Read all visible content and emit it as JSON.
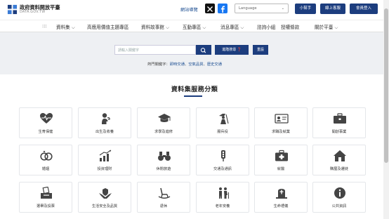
{
  "header": {
    "logo_title": "政府資料開放平臺",
    "logo_sub": "DATA.GOV.TW",
    "sitemap": "網站導覽",
    "x_icon": "x-twitter-icon",
    "fb_icon": "facebook-icon",
    "language_value": "Language",
    "btn_beginner": "小幫手",
    "btn_online_service": "線上客服",
    "btn_member_login": "會員登入",
    "accent": "#1c3d7e"
  },
  "nav": {
    "menu_glyph": ":::",
    "items": [
      {
        "label": "資料集 ⌵"
      },
      {
        "label": "高應用價值主題專區"
      },
      {
        "label": "資料故事館 ⌵"
      },
      {
        "label": "互動專區 ⌵"
      },
      {
        "label": "消息專區 ⌵"
      },
      {
        "label": "諮詢小組"
      },
      {
        "label": "授權條款"
      },
      {
        "label": "關於平臺 ⌵"
      }
    ]
  },
  "search": {
    "placeholder": "請輸入關鍵字",
    "advanced_label": "進階搜尋 ❓",
    "clear_label": "重設",
    "hot_prefix": "熱門關鍵字：",
    "hot_keywords": [
      "即時交通",
      "空氣品質",
      "歷史交通"
    ],
    "hot_sep": "、"
  },
  "section": {
    "title": "資料集服務分類"
  },
  "categories": [
    {
      "label": "生育保健",
      "icon": "heartbeat-icon"
    },
    {
      "label": "出生及收養",
      "icon": "baby-icon"
    },
    {
      "label": "求學及進修",
      "icon": "graduation-cap-icon"
    },
    {
      "label": "服兵役",
      "icon": "soldier-icon"
    },
    {
      "label": "求職及就業",
      "icon": "id-card-icon"
    },
    {
      "label": "開創事業",
      "icon": "briefcase-icon"
    },
    {
      "label": "婚姻",
      "icon": "rings-icon"
    },
    {
      "label": "投資理財",
      "icon": "growth-chart-icon"
    },
    {
      "label": "休閒旅遊",
      "icon": "binoculars-icon"
    },
    {
      "label": "交通及通訊",
      "icon": "traffic-light-icon"
    },
    {
      "label": "就醫",
      "icon": "medical-kit-icon"
    },
    {
      "label": "購屋及遷徙",
      "icon": "house-icon"
    },
    {
      "label": "選舉及投票",
      "icon": "ballot-box-icon"
    },
    {
      "label": "生活安全及品質",
      "icon": "hands-shield-icon"
    },
    {
      "label": "退休",
      "icon": "rocking-chair-icon"
    },
    {
      "label": "老年安養",
      "icon": "elderly-couple-icon"
    },
    {
      "label": "生命禮儀",
      "icon": "tombstone-icon"
    },
    {
      "label": "公共資訊",
      "icon": "info-circle-icon"
    }
  ]
}
